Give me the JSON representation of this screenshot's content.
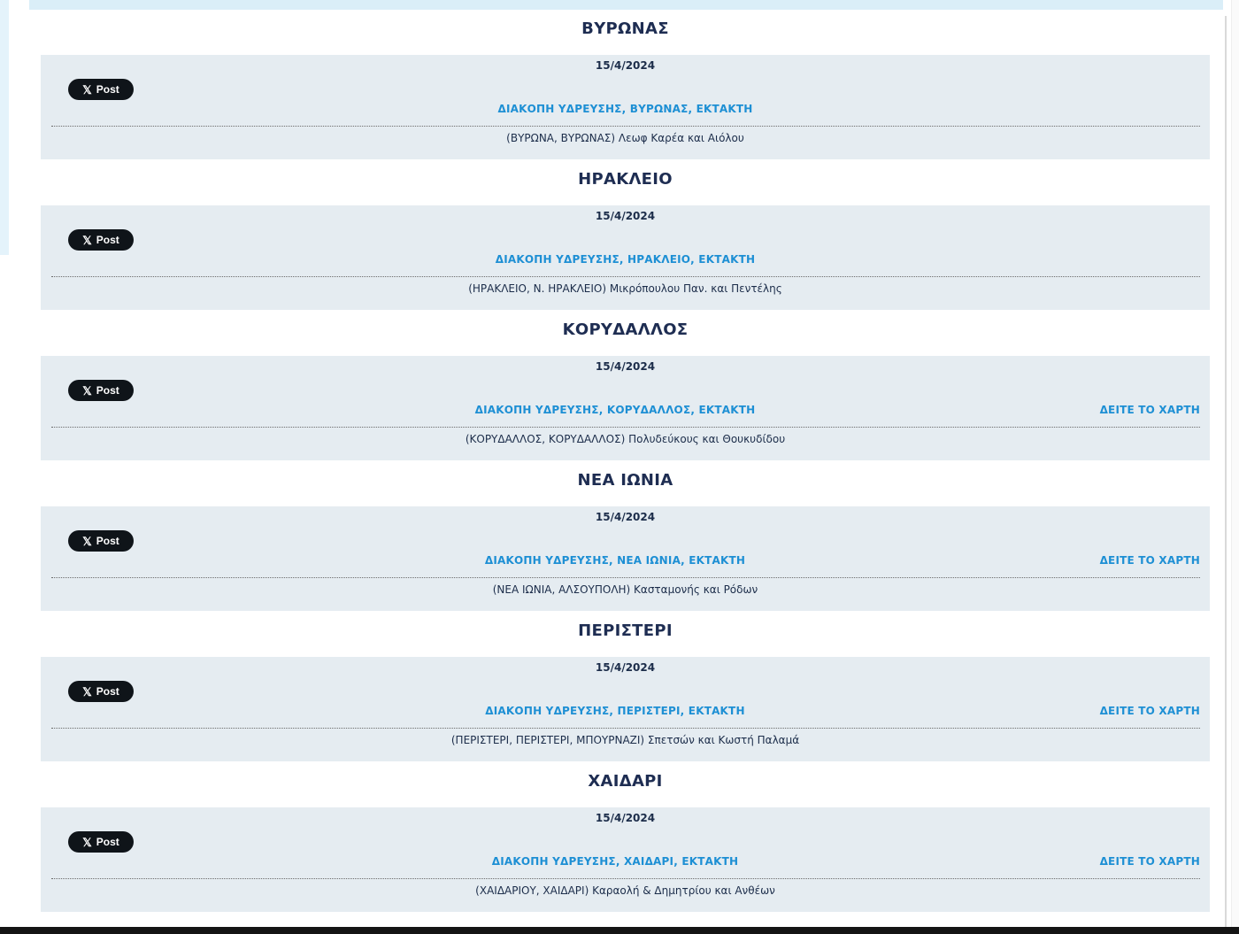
{
  "x_post_label": "Post",
  "x_logo": "𝕏",
  "entries": [
    {
      "area": "ΒΥΡΩΝΑΣ",
      "date": "15/4/2024",
      "title": "ΔΙΑΚΟΠΗ ΥΔΡΕΥΣΗΣ, ΒΥΡΩΝΑΣ, ΕΚΤΑΚΤΗ",
      "map_link": "",
      "address": "(ΒΥΡΩΝΑ, ΒΥΡΩΝΑΣ) Λεωφ Καρέα και Αιόλου"
    },
    {
      "area": "ΗΡΑΚΛΕΙΟ",
      "date": "15/4/2024",
      "title": "ΔΙΑΚΟΠΗ ΥΔΡΕΥΣΗΣ, ΗΡΑΚΛΕΙΟ, ΕΚΤΑΚΤΗ",
      "map_link": "",
      "address": "(ΗΡΑΚΛΕΙΟ, Ν. ΗΡΑΚΛΕΙΟ) Μικρόπουλου Παν. και Πεντέλης"
    },
    {
      "area": "ΚΟΡΥΔΑΛΛΟΣ",
      "date": "15/4/2024",
      "title": "ΔΙΑΚΟΠΗ ΥΔΡΕΥΣΗΣ, ΚΟΡΥΔΑΛΛΟΣ, ΕΚΤΑΚΤΗ",
      "map_link": "ΔΕΙΤΕ ΤΟ ΧΑΡΤΗ",
      "address": "(ΚΟΡΥΔΑΛΛΟΣ, ΚΟΡΥΔΑΛΛΟΣ) Πολυδεύκους και Θουκυδίδου"
    },
    {
      "area": "ΝΕΑ ΙΩΝΙΑ",
      "date": "15/4/2024",
      "title": "ΔΙΑΚΟΠΗ ΥΔΡΕΥΣΗΣ, ΝΕΑ ΙΩΝΙΑ, ΕΚΤΑΚΤΗ",
      "map_link": "ΔΕΙΤΕ ΤΟ ΧΑΡΤΗ",
      "address": "(ΝΕΑ ΙΩΝΙΑ, ΑΛΣΟΥΠΟΛΗ) Κασταμονής και Ρόδων"
    },
    {
      "area": "ΠΕΡΙΣΤΕΡΙ",
      "date": "15/4/2024",
      "title": "ΔΙΑΚΟΠΗ ΥΔΡΕΥΣΗΣ, ΠΕΡΙΣΤΕΡΙ, ΕΚΤΑΚΤΗ",
      "map_link": "ΔΕΙΤΕ ΤΟ ΧΑΡΤΗ",
      "address": "(ΠΕΡΙΣΤΕΡΙ, ΠΕΡΙΣΤΕΡΙ, ΜΠΟΥΡΝΑΖΙ) Σπετσών και Κωστή Παλαμά"
    },
    {
      "area": "ΧΑΙΔΑΡΙ",
      "date": "15/4/2024",
      "title": "ΔΙΑΚΟΠΗ ΥΔΡΕΥΣΗΣ, ΧΑΙΔΑΡΙ, ΕΚΤΑΚΤΗ",
      "map_link": "ΔΕΙΤΕ ΤΟ ΧΑΡΤΗ",
      "address": "(ΧΑΙΔΑΡΙΟΥ, ΧΑΙΔΑΡΙ) Καραολή & Δημητρίου και Ανθέων"
    }
  ]
}
